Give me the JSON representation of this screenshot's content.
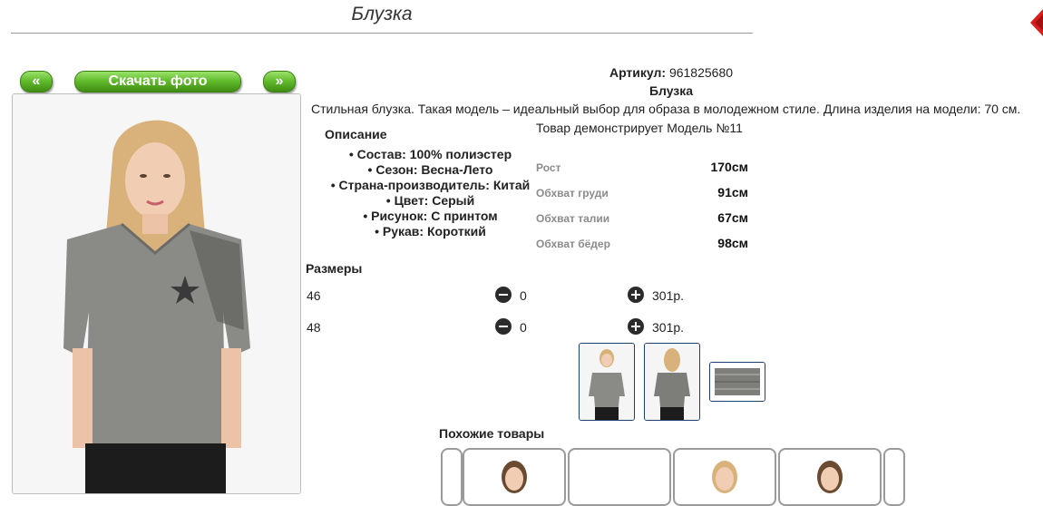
{
  "header": {
    "title": "Блузка"
  },
  "gallery": {
    "prev_label": "«",
    "download_label": "Скачать фото",
    "next_label": "»"
  },
  "product": {
    "sku_label": "Артикул:",
    "sku_value": "961825680",
    "name": "Блузка",
    "description": "Стильная блузка. Такая модель – идеальный выбор для образа в молодежном стиле. Длина изделия на модели: 70 см.",
    "model_note": "Товар демонстрирует Модель №11"
  },
  "details": {
    "title": "Описание",
    "features": [
      "Состав: 100% полиэстер",
      "Сезон: Весна-Лето",
      "Страна-производитель: Китай",
      "Цвет: Серый",
      "Рисунок: С принтом",
      "Рукав: Короткий"
    ]
  },
  "measurements": [
    {
      "label": "Рост",
      "value": "170см"
    },
    {
      "label": "Обхват груди",
      "value": "91см"
    },
    {
      "label": "Обхват талии",
      "value": "67см"
    },
    {
      "label": "Обхват бёдер",
      "value": "98см"
    }
  ],
  "sizes": {
    "title": "Размеры",
    "rows": [
      {
        "size": "46",
        "qty": "0",
        "price": "301р."
      },
      {
        "size": "48",
        "qty": "0",
        "price": "301р."
      }
    ]
  },
  "similar": {
    "title": "Похожие товары"
  },
  "colors": {
    "accent_green": "#5fb82a",
    "close_red": "#d91e1e",
    "thumb_border": "#1d3f6b"
  }
}
